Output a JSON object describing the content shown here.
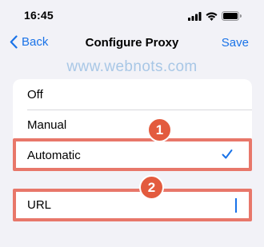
{
  "status_bar": {
    "time": "16:45",
    "icons": [
      "cellular-signal-icon",
      "wifi-icon",
      "battery-icon"
    ]
  },
  "nav": {
    "back_label": "Back",
    "title": "Configure Proxy",
    "save_label": "Save",
    "accent_color": "#1a73e8"
  },
  "watermark": "www.webnots.com",
  "proxy_modes": {
    "options": [
      "Off",
      "Manual",
      "Automatic"
    ],
    "selected": "Automatic"
  },
  "url_field": {
    "label": "URL",
    "value": ""
  },
  "annotations": {
    "step_1": "1",
    "step_2": "2",
    "highlight_color": "#e8776a",
    "badge_color": "#e35b3e"
  }
}
